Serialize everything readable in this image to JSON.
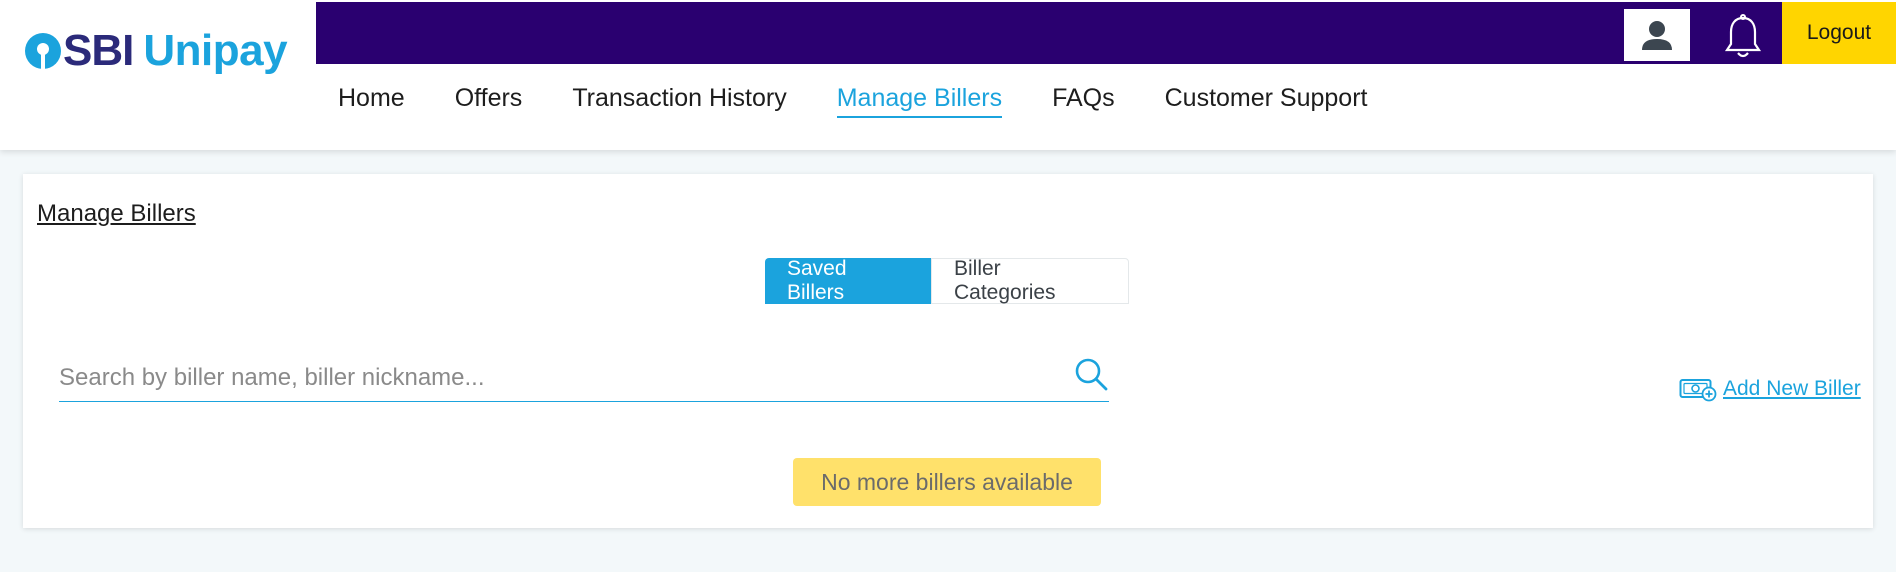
{
  "brand": {
    "logo_sbi": "SBI",
    "logo_unipay": "Unipay",
    "colors": {
      "primary": "#1ba3dd",
      "navy": "#2a0070",
      "logout_bg": "#ffd500",
      "notice_bg": "#ffe16b"
    }
  },
  "topbar": {
    "profile_icon": "user-icon",
    "notification_icon": "bell-icon",
    "logout_label": "Logout"
  },
  "nav": {
    "items": [
      {
        "label": "Home",
        "active": false
      },
      {
        "label": "Offers",
        "active": false
      },
      {
        "label": "Transaction History",
        "active": false
      },
      {
        "label": "Manage Billers",
        "active": true
      },
      {
        "label": "FAQs",
        "active": false
      },
      {
        "label": "Customer Support",
        "active": false
      }
    ]
  },
  "page": {
    "title": "Manage Billers",
    "tabs": [
      {
        "label": "Saved Billers",
        "active": true
      },
      {
        "label": "Biller Categories",
        "active": false
      }
    ],
    "search": {
      "value": "",
      "placeholder": "Search by biller name, biller nickname...",
      "icon": "search-icon"
    },
    "add_biller": {
      "label": "Add New Biller",
      "icon": "add-money-icon"
    },
    "empty_message": "No more billers available"
  }
}
